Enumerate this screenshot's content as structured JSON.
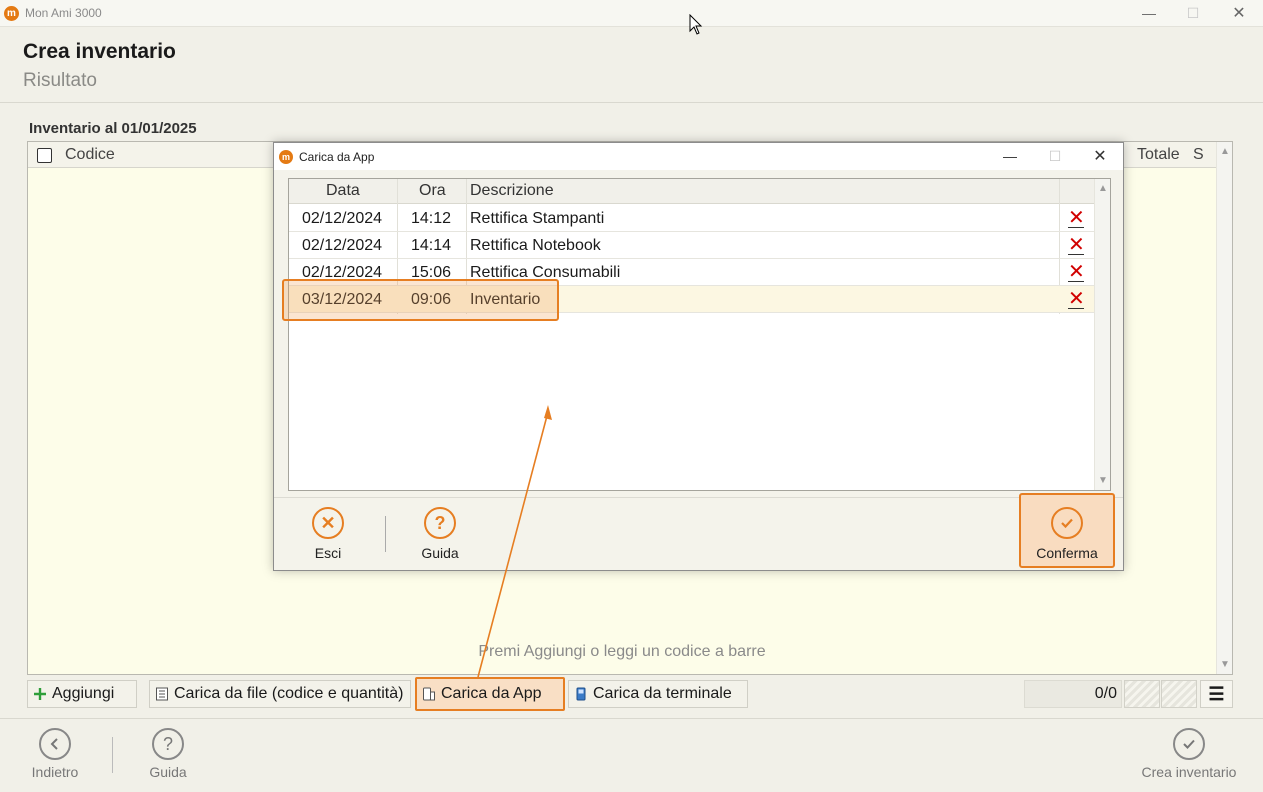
{
  "window": {
    "app_title": "Mon Ami 3000",
    "min_glyph": "—",
    "max_glyph": "☐",
    "close_glyph": "✕",
    "logo_letter": "m"
  },
  "header": {
    "title": "Crea inventario",
    "subtitle": "Risultato"
  },
  "inventory": {
    "label": "Inventario al 01/01/2025",
    "columns": {
      "code": "Codice",
      "total": "Totale",
      "s": "S"
    },
    "empty_hint": "Premi Aggiungi o leggi un codice a barre"
  },
  "toolbar": {
    "add": "Aggiungi",
    "load_file": "Carica da file (codice e quantità)",
    "load_app": "Carica da App",
    "load_terminal": "Carica da terminale",
    "counter": "0/0",
    "menu_glyph": "☰"
  },
  "footer": {
    "back": "Indietro",
    "help": "Guida",
    "create": "Crea inventario"
  },
  "dialog": {
    "title": "Carica da App",
    "columns": {
      "date": "Data",
      "time": "Ora",
      "description": "Descrizione"
    },
    "rows": [
      {
        "date": "02/12/2024",
        "time": "14:12",
        "description": "Rettifica Stampanti"
      },
      {
        "date": "02/12/2024",
        "time": "14:14",
        "description": "Rettifica Notebook"
      },
      {
        "date": "02/12/2024",
        "time": "15:06",
        "description": "Rettifica Consumabili"
      },
      {
        "date": "03/12/2024",
        "time": "09:06",
        "description": "Inventario"
      }
    ],
    "selected_row": 3,
    "delete_glyph": "✕",
    "buttons": {
      "exit": "Esci",
      "help": "Guida",
      "confirm": "Conferma"
    }
  },
  "colors": {
    "accent": "#e67e22",
    "delete": "#d10000",
    "table_bg": "#fdfde9"
  }
}
